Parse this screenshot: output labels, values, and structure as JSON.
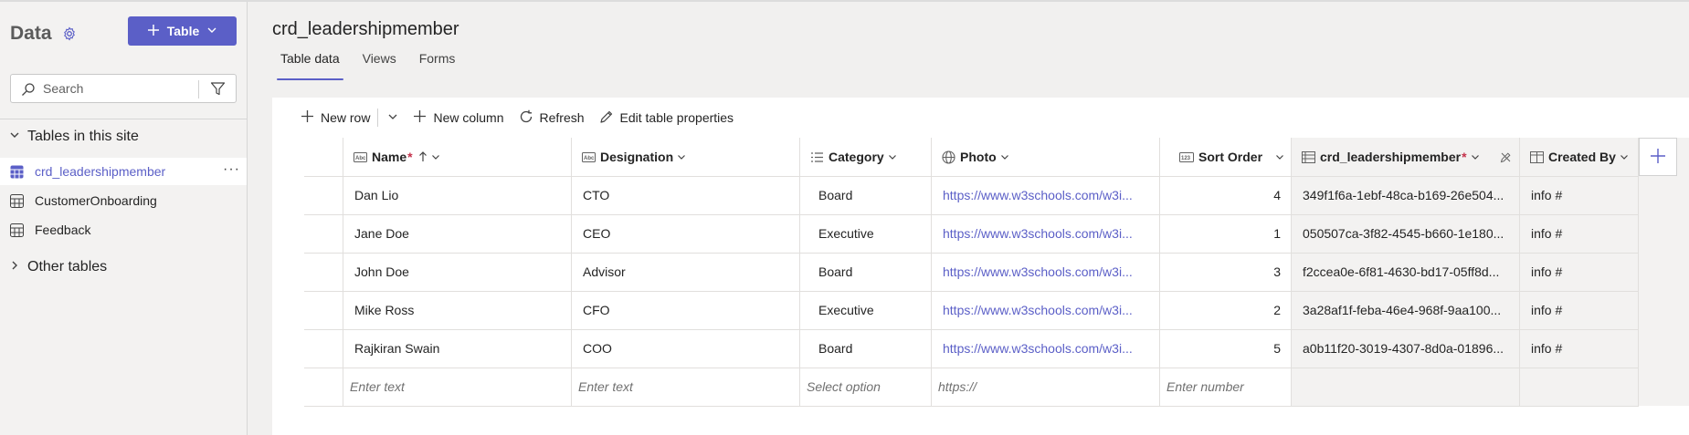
{
  "sidebar": {
    "title": "Data",
    "add_table_label": "Table",
    "search_placeholder": "Search",
    "tables_section_label": "Tables in this site",
    "tables": [
      {
        "label": "crd_leadershipmember",
        "active": true
      },
      {
        "label": "CustomerOnboarding",
        "active": false
      },
      {
        "label": "Feedback",
        "active": false
      }
    ],
    "other_section_label": "Other tables"
  },
  "main": {
    "title": "crd_leadershipmember",
    "tabs": [
      "Table data",
      "Views",
      "Forms"
    ],
    "active_tab": "Table data"
  },
  "toolbar": {
    "new_row": "New row",
    "new_column": "New column",
    "refresh": "Refresh",
    "edit_props": "Edit table properties"
  },
  "table": {
    "headers": {
      "name": "Name",
      "designation": "Designation",
      "category": "Category",
      "photo": "Photo",
      "sort_order": "Sort Order",
      "id": "crd_leadershipmember",
      "created_by": "Created By"
    },
    "rows": [
      {
        "name": "Dan Lio",
        "designation": "CTO",
        "category": "Board",
        "photo": "https://www.w3schools.com/w3i...",
        "sort_order": "4",
        "id": "349f1f6a-1ebf-48ca-b169-26e504...",
        "created_by": "info #"
      },
      {
        "name": "Jane Doe",
        "designation": "CEO",
        "category": "Executive",
        "photo": "https://www.w3schools.com/w3i...",
        "sort_order": "1",
        "id": "050507ca-3f82-4545-b660-1e180...",
        "created_by": "info #"
      },
      {
        "name": "John Doe",
        "designation": "Advisor",
        "category": "Board",
        "photo": "https://www.w3schools.com/w3i...",
        "sort_order": "3",
        "id": "f2ccea0e-6f81-4630-bd17-05ff8d...",
        "created_by": "info #"
      },
      {
        "name": "Mike Ross",
        "designation": "CFO",
        "category": "Executive",
        "photo": "https://www.w3schools.com/w3i...",
        "sort_order": "2",
        "id": "3a28af1f-feba-46e4-968f-9aa100...",
        "created_by": "info #"
      },
      {
        "name": "Rajkiran Swain",
        "designation": "COO",
        "category": "Board",
        "photo": "https://www.w3schools.com/w3i...",
        "sort_order": "5",
        "id": "a0b11f20-3019-4307-8d0a-01896...",
        "created_by": "info #"
      }
    ],
    "new_row_placeholders": {
      "name": "Enter text",
      "designation": "Enter text",
      "category": "Select option",
      "photo": "https://",
      "sort_order": "Enter number"
    }
  },
  "colors": {
    "accent": "#5b5fc7",
    "required": "#c4314b",
    "readonly_bg": "#f3f2f1"
  }
}
